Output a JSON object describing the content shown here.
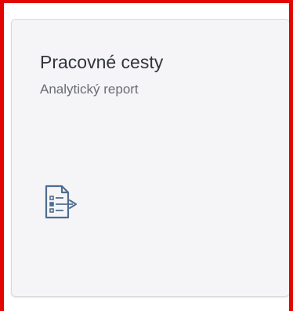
{
  "tile": {
    "title": "Pracovné cesty",
    "subtitle": "Analytický report",
    "icon": "report-list-icon"
  },
  "colors": {
    "highlight": "#e10600",
    "tile_background": "#f5f5f8",
    "icon": "#4f6d8f"
  }
}
